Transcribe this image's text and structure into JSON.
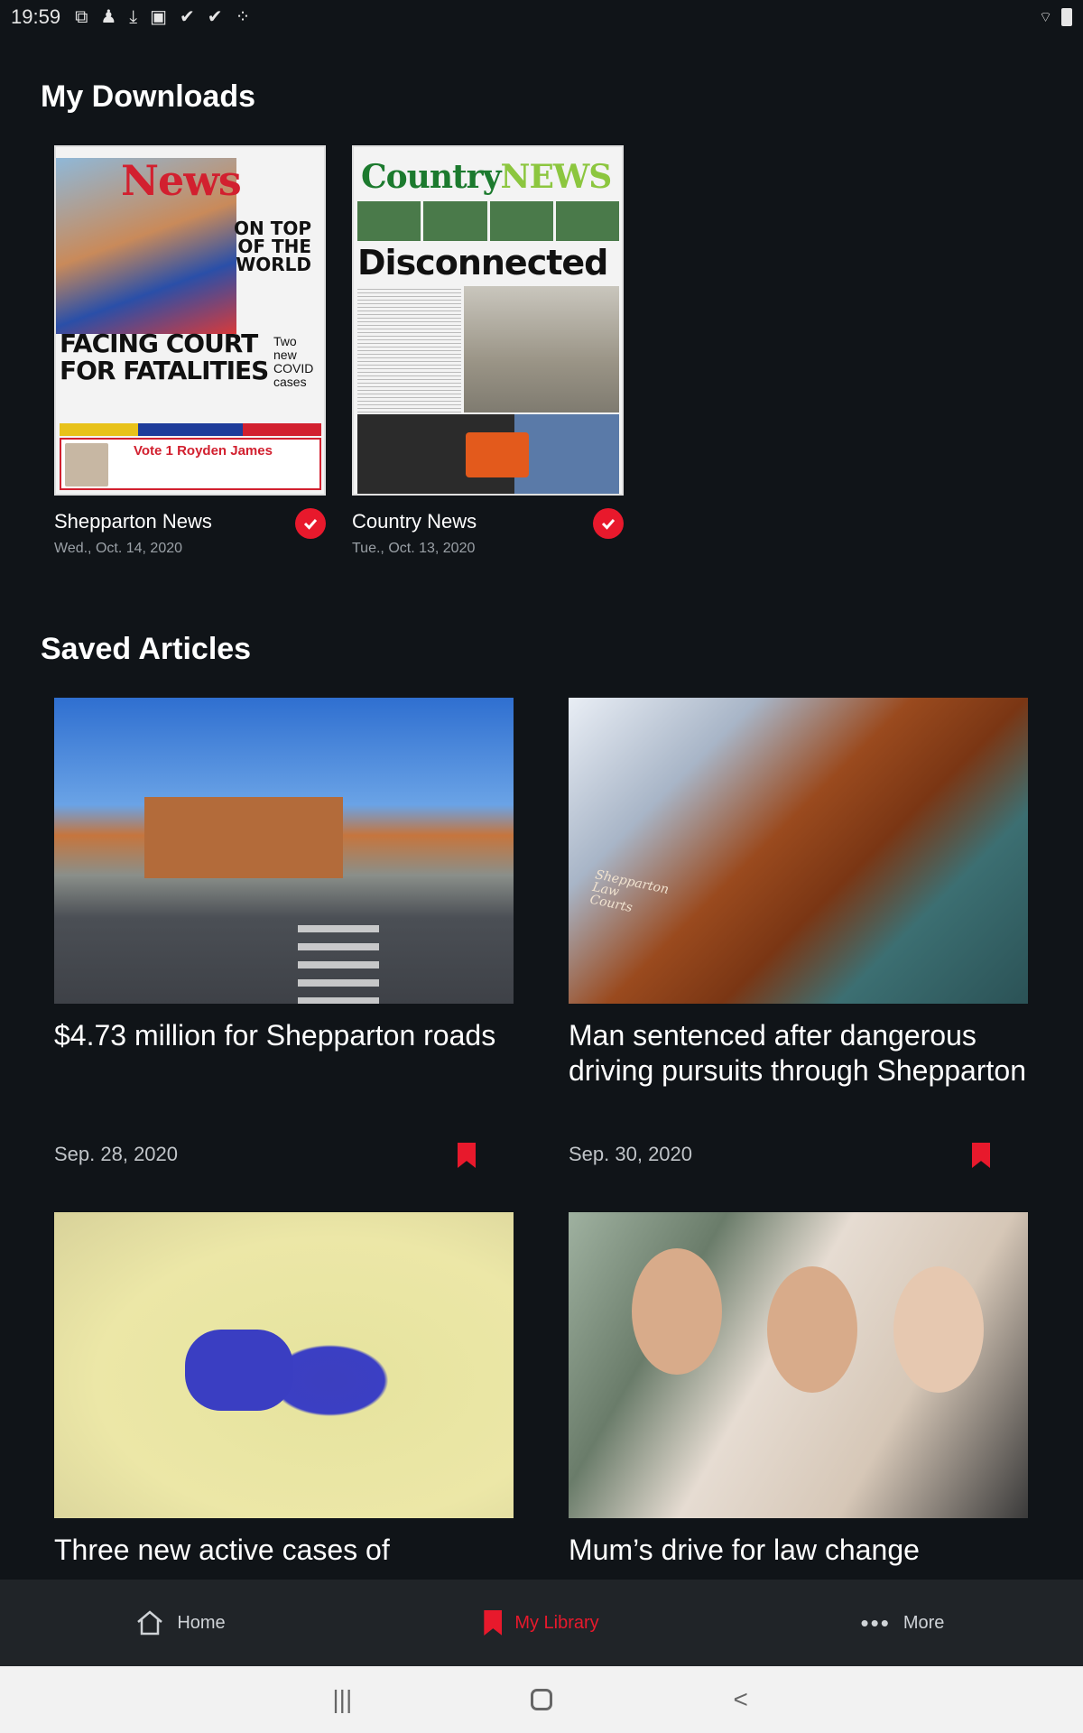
{
  "status": {
    "time": "19:59",
    "icons": [
      "screenshot-icon",
      "download-icon",
      "gallery-icon",
      "check-icon",
      "check-icon",
      "dots-icon"
    ]
  },
  "downloads": {
    "title": "My Downloads",
    "items": [
      {
        "name": "Shepparton News",
        "date": "Wed., Oct. 14, 2020",
        "cover": {
          "masthead": "News",
          "tag": "ON TOP OF THE WORLD",
          "headline": "FACING COURT FOR FATALITIES",
          "side": "Two new COVID cases",
          "ad": "Vote 1 Royden James"
        }
      },
      {
        "name": "Country News",
        "date": "Tue., Oct. 13, 2020",
        "cover": {
          "masthead_a": "Country",
          "masthead_b": "NEWS",
          "headline": "Disconnected"
        }
      }
    ]
  },
  "articles": {
    "title": "Saved Articles",
    "items": [
      {
        "title": "$4.73 million for Shepparton roads",
        "date": "Sep. 28, 2020"
      },
      {
        "title": "Man sentenced after dangerous driving pursuits through Shepparton",
        "date": "Sep. 30, 2020",
        "image_text": "Shepparton Law Courts"
      },
      {
        "title": "Three new active cases of",
        "date": ""
      },
      {
        "title": "Mum’s drive for law change",
        "date": ""
      }
    ]
  },
  "nav": {
    "home": "Home",
    "library": "My Library",
    "more": "More"
  },
  "colors": {
    "accent": "#e8192c",
    "background": "#101418",
    "nav_bg": "#202428"
  }
}
